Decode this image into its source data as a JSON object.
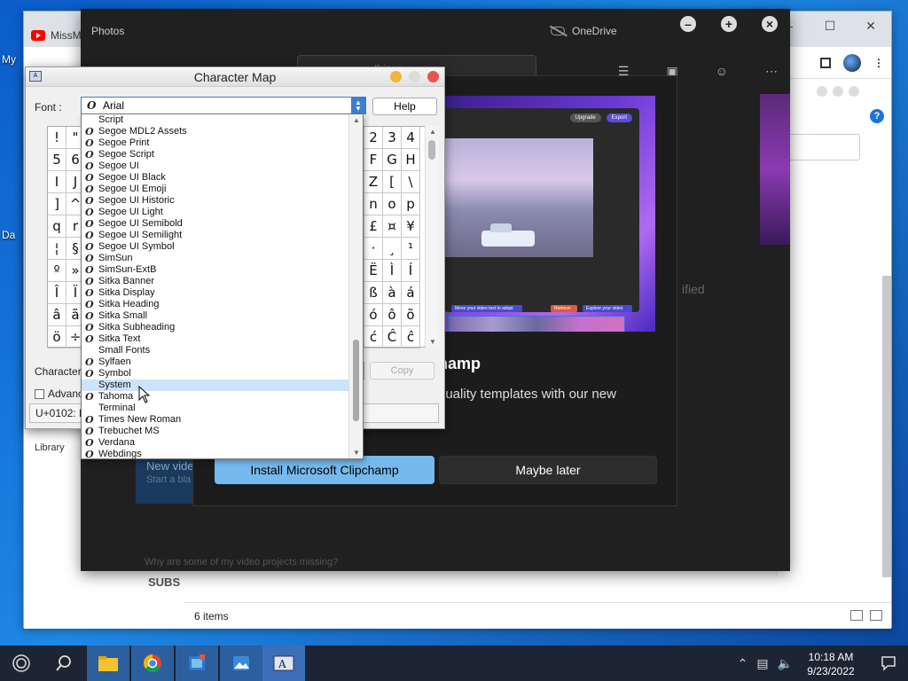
{
  "desktop": {
    "labels": [
      "My",
      "Da"
    ]
  },
  "browser": {
    "tab_title": "MissM",
    "status_items": "6 items",
    "library_label": "Library",
    "subs_label": "SUBS",
    "help_icon": "?"
  },
  "photos": {
    "title": "Photos",
    "onedrive": "OneDrive",
    "search_placeholder": "things",
    "modified": "ified",
    "new_video_title": "New vide",
    "new_video_sub": "Start a bla",
    "help_link": "Why are some of my video projects missing?",
    "clipchamp": {
      "title": "hamp",
      "description": "quality templates with our new",
      "install_button": "Install Microsoft Clipchamp",
      "later_button": "Maybe later",
      "promo_badges": [
        "Upgrade",
        "Export"
      ],
      "promo_chips": [
        "Move your video text to adopt",
        "Remove",
        "Explore your video"
      ]
    }
  },
  "charmap": {
    "title": "Character Map",
    "font_label": "Font :",
    "selected_font": "Arial",
    "help_button": "Help",
    "characters_label": "Characters",
    "copy_button": "Copy",
    "advanced_label": "Advanc",
    "status": "U+0102: La",
    "grid_chars": [
      "!",
      "\"",
      "",
      "",
      "",
      "",
      "",
      "",
      "",
      "",
      "",
      "",
      "",
      "",
      "",
      "",
      "",
      "2",
      "3",
      "4",
      "5",
      "6",
      "",
      "",
      "",
      "",
      "",
      "",
      "",
      "",
      "",
      "",
      "",
      "",
      "",
      "",
      "",
      "F",
      "G",
      "H",
      "I",
      "J",
      "",
      "",
      "",
      "",
      "",
      "",
      "",
      "",
      "",
      "",
      "",
      "",
      "",
      "",
      "",
      "Z",
      "[",
      "\\",
      "]",
      "^",
      "",
      "",
      "",
      "",
      "",
      "",
      "",
      "",
      "",
      "",
      "",
      "",
      "",
      "",
      "",
      "n",
      "o",
      "p",
      "q",
      "r",
      "",
      "",
      "",
      "",
      "",
      "",
      "",
      "",
      "",
      "",
      "",
      "",
      "",
      "",
      "",
      "£",
      "¤",
      "¥",
      "¦",
      "§",
      "",
      "",
      "",
      "",
      "",
      "",
      "",
      "",
      "",
      "",
      "",
      "",
      "",
      "",
      "",
      "·",
      "¸",
      "¹",
      "º",
      "»",
      "",
      "",
      "",
      "",
      "",
      "",
      "",
      "",
      "",
      "",
      "",
      "",
      "",
      "",
      "",
      "Ë",
      "Ì",
      "Í",
      "Î",
      "Ï",
      "",
      "",
      "",
      "",
      "",
      "",
      "",
      "",
      "",
      "",
      "",
      "",
      "",
      "",
      "",
      "ß",
      "à",
      "á",
      "â",
      "ã",
      "",
      "",
      "",
      "",
      "",
      "",
      "",
      "",
      "",
      "",
      "",
      "",
      "",
      "",
      "",
      "ó",
      "ô",
      "õ",
      "ö",
      "÷",
      "",
      "",
      "",
      "",
      "",
      "",
      "",
      "",
      "",
      "",
      "",
      "",
      "",
      "",
      "",
      "ć",
      "Ĉ",
      "ĉ"
    ],
    "font_list": [
      {
        "name": "Script",
        "otf": false
      },
      {
        "name": "Segoe MDL2 Assets",
        "otf": true
      },
      {
        "name": "Segoe Print",
        "otf": true
      },
      {
        "name": "Segoe Script",
        "otf": true
      },
      {
        "name": "Segoe UI",
        "otf": true
      },
      {
        "name": "Segoe UI Black",
        "otf": true
      },
      {
        "name": "Segoe UI Emoji",
        "otf": true
      },
      {
        "name": "Segoe UI Historic",
        "otf": true
      },
      {
        "name": "Segoe UI Light",
        "otf": true
      },
      {
        "name": "Segoe UI Semibold",
        "otf": true
      },
      {
        "name": "Segoe UI Semilight",
        "otf": true
      },
      {
        "name": "Segoe UI Symbol",
        "otf": true
      },
      {
        "name": "SimSun",
        "otf": true
      },
      {
        "name": "SimSun-ExtB",
        "otf": true
      },
      {
        "name": "Sitka Banner",
        "otf": true
      },
      {
        "name": "Sitka Display",
        "otf": true
      },
      {
        "name": "Sitka Heading",
        "otf": true
      },
      {
        "name": "Sitka Small",
        "otf": true
      },
      {
        "name": "Sitka Subheading",
        "otf": true
      },
      {
        "name": "Sitka Text",
        "otf": true
      },
      {
        "name": "Small Fonts",
        "otf": false
      },
      {
        "name": "Sylfaen",
        "otf": true
      },
      {
        "name": "Symbol",
        "otf": true
      },
      {
        "name": "System",
        "otf": false,
        "selected": true
      },
      {
        "name": "Tahoma",
        "otf": true
      },
      {
        "name": "Terminal",
        "otf": false
      },
      {
        "name": "Times New Roman",
        "otf": true
      },
      {
        "name": "Trebuchet MS",
        "otf": true
      },
      {
        "name": "Verdana",
        "otf": true
      },
      {
        "name": "Webdings",
        "otf": true
      }
    ]
  },
  "taskbar": {
    "time": "10:18 AM",
    "date": "9/23/2022",
    "apps": [
      "file-explorer",
      "chrome",
      "video-editor",
      "photos",
      "character-map"
    ]
  },
  "colors": {
    "accent": "#76b9ed",
    "selection": "#cde3fb",
    "taskbar": "#1d2433",
    "mac_red": "#e8544a",
    "mac_yellow": "#f2b53a"
  }
}
